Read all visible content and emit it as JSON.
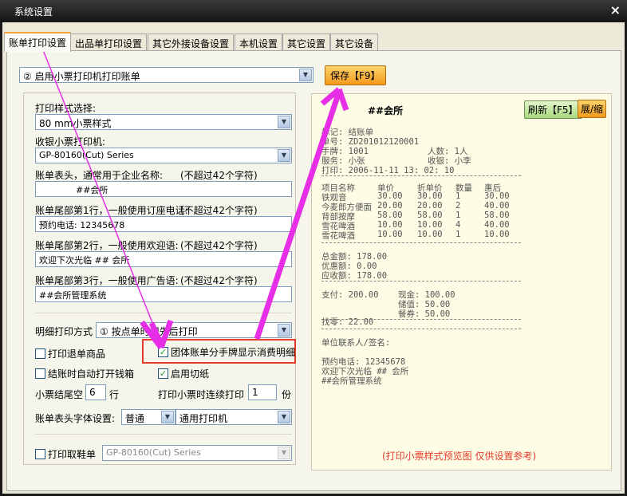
{
  "window": {
    "title": "系统设置",
    "close_glyph": "×"
  },
  "tabs": [
    "账单打印设置",
    "出品单打印设置",
    "其它外接设备设置",
    "本机设置",
    "其它设置",
    "其它设备"
  ],
  "top": {
    "mode_select": "② 启用小票打印机打印账单",
    "save_button": "保存【F9】"
  },
  "left": {
    "style_label": "打印样式选择:",
    "style_value": "80  mm小票样式",
    "printer_label": "收银小票打印机:",
    "printer_value": "GP-80160(Cut) Series",
    "header_label": "账单表头，通常用于企业名称:",
    "header_hint": "(不超过42个字符)",
    "header_value": "##会所",
    "footer1_label": "账单尾部第1行，一般使用订座电话:",
    "footer1_hint": "(不超过42个字符)",
    "footer1_value": "预约电话: 12345678",
    "footer2_label": "账单尾部第2行，一般使用欢迎语:",
    "footer2_hint": "(不超过42个字符)",
    "footer2_value": "欢迎下次光临 ## 会所",
    "footer3_label": "账单尾部第3行，一般使用广告语:",
    "footer3_hint": "(不超过42个字符)",
    "footer3_value": "##会所管理系统",
    "detail_label": "明细打印方式",
    "detail_value": "① 按点单时间先后打印",
    "chk_refund": "打印退单商品",
    "chk_group": "团体账单分手牌显示消费明细",
    "chk_drawer": "结账时自动打开钱箱",
    "chk_cut": "启用切纸",
    "tail_label": "小票结尾空",
    "tail_value": "6",
    "tail_unit": "行",
    "copies_label": "打印小票时连续打印",
    "copies_value": "1",
    "copies_unit": "份",
    "font_label": "账单表头字体设置:",
    "font_value": "普通",
    "font_printer": "通用打印机",
    "shoe_label": "打印取鞋单",
    "shoe_printer": "GP-80160(Cut) Series"
  },
  "preview": {
    "refresh_button": "刷新【F5】",
    "shrink_button": "展/缩",
    "title": "##会所",
    "mark": "标记: 结账单",
    "serial": "单号: ZD201012120001",
    "card": "手牌: 1001",
    "people": "人数: 1人",
    "service": "服务: 小张",
    "cashier": "收银: 小李",
    "print_time": "打印: 2006-11-11 13: 02: 10",
    "columns": [
      "项目名称",
      "单价",
      "折单价",
      "数量",
      "惠后"
    ],
    "rows": [
      [
        "铁观音",
        "30.00",
        "30.00",
        "1",
        "30.00"
      ],
      [
        "今麦郎方便面",
        "20.00",
        "20.00",
        "2",
        "40.00"
      ],
      [
        "背部按摩",
        "58.00",
        "58.00",
        "1",
        "58.00"
      ],
      [
        "雪花啤酒",
        "10.00",
        "10.00",
        "4",
        "40.00"
      ],
      [
        "雪花啤酒",
        "10.00",
        "10.00",
        "1",
        "10.00"
      ]
    ],
    "total": "总金额: 178.00",
    "discount": "优惠额: 0.00",
    "due": "应收额: 178.00",
    "pay": "支付: 200.00",
    "cash": "现金: 100.00",
    "stored": "储值: 50.00",
    "voucher": "餐券: 50.00",
    "change": "找零: 22.00",
    "sign": "单位联系人/签名:",
    "foot1": "预约电话: 12345678",
    "foot2": "欢迎下次光临 ## 会所",
    "foot3": "##会所管理系统",
    "note": "(打印小票样式预览图 仅供设置参考)"
  },
  "colors": {
    "accent_orange": "#f39a1d",
    "highlight_red": "#e53b2b",
    "arrow_magenta": "#e62ee6"
  }
}
